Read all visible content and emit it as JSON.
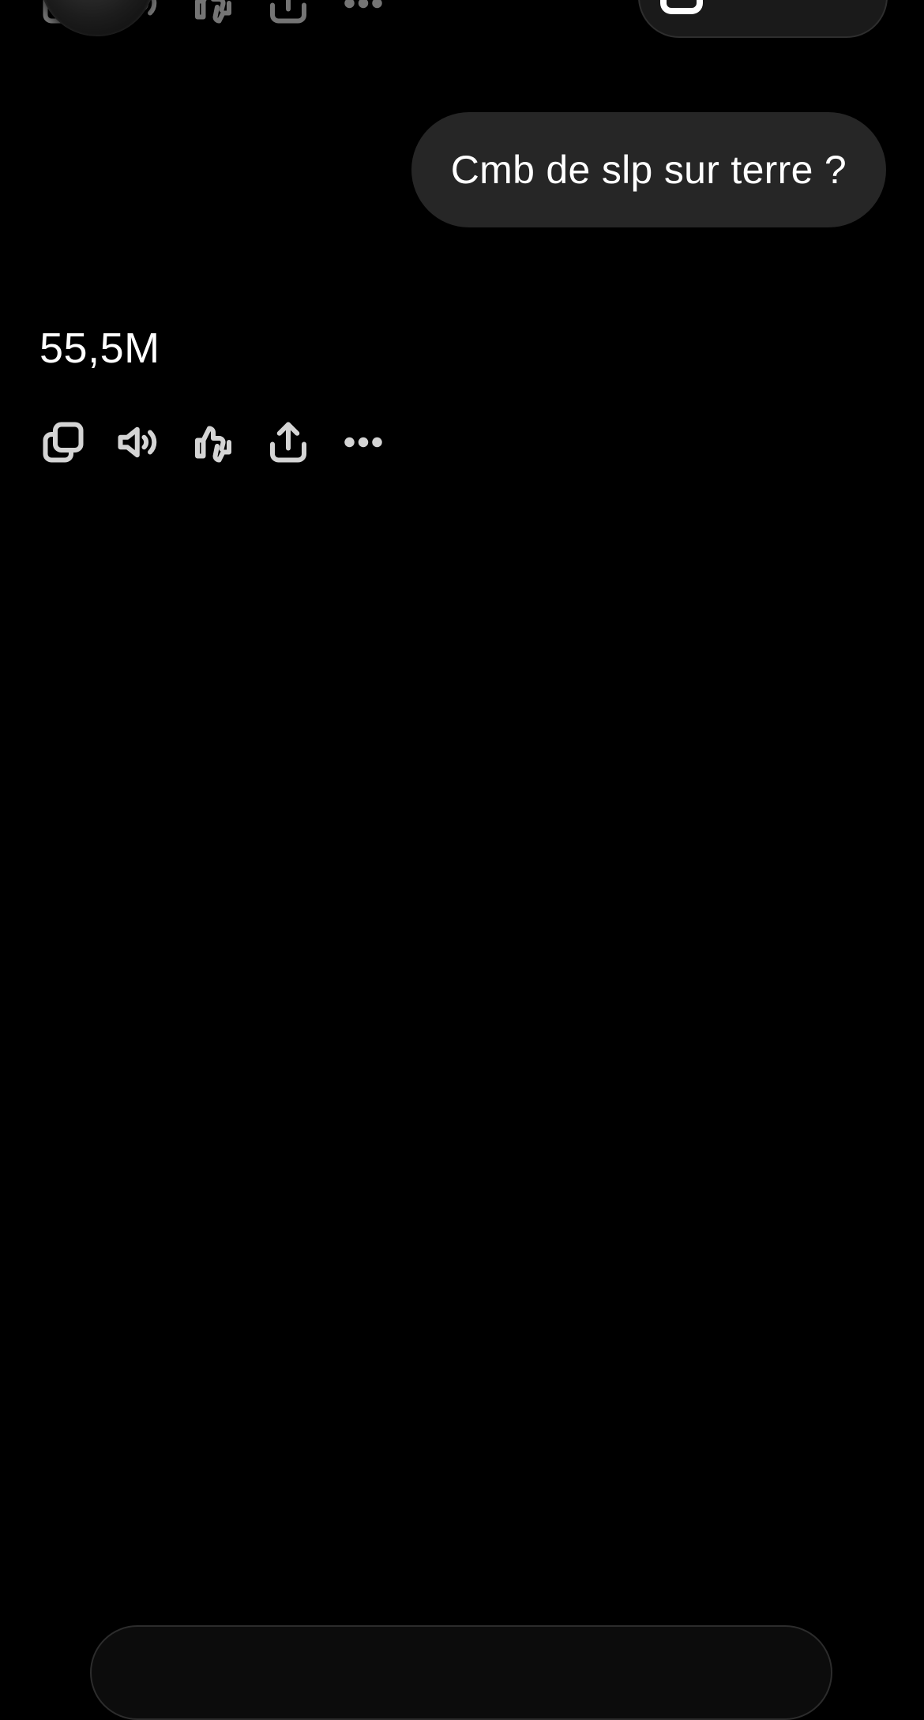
{
  "user_message": {
    "text": "Cmb de slp sur terre ?"
  },
  "assistant_message": {
    "text": "55,5M",
    "actions": [
      {
        "name": "copy",
        "icon": "copy-icon"
      },
      {
        "name": "read-aloud",
        "icon": "speaker-icon"
      },
      {
        "name": "feedback",
        "icon": "thumbs-icon"
      },
      {
        "name": "share",
        "icon": "share-icon"
      },
      {
        "name": "more",
        "icon": "more-icon"
      }
    ]
  },
  "colors": {
    "background": "#000000",
    "bubble": "#262626",
    "icon": "#d4d4d4",
    "text": "#ffffff"
  }
}
